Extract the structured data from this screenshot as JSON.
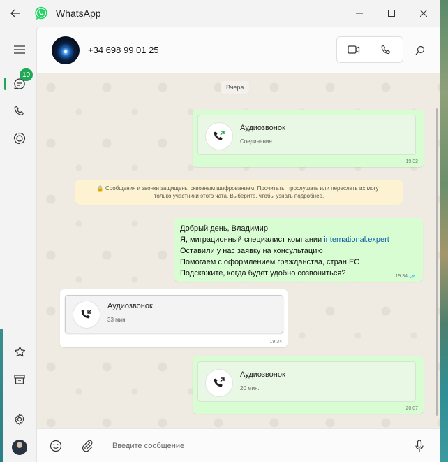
{
  "window": {
    "app_title": "WhatsApp"
  },
  "sidebar": {
    "chats_badge": "10"
  },
  "header": {
    "contact_name": "+34 698 99 01 25"
  },
  "date_separator": "Вчера",
  "messages": [
    {
      "type": "call",
      "direction": "out",
      "title": "Аудиозвонок",
      "subtitle": "Соединение",
      "time": "19:32"
    },
    {
      "type": "text",
      "direction": "out",
      "line1": "Добрый день, Владимир",
      "line2_prefix": "Я, миграционный специалист компании ",
      "line2_link": "international.expert",
      "line3": "Оставили у нас заявку на консультацию",
      "line4": "Помогаем с оформлением гражданства, стран ЕС",
      "line5": "Подскажите, когда будет удобно созвониться?",
      "time": "19:34"
    },
    {
      "type": "call",
      "direction": "in",
      "title": "Аудиозвонок",
      "subtitle": "33 мин.",
      "time": "19:34"
    },
    {
      "type": "call",
      "direction": "out",
      "title": "Аудиозвонок",
      "subtitle": "20 мин.",
      "time": "20:07"
    }
  ],
  "encryption_notice": {
    "line1": "🔒 Сообщения и звонки защищены сквозным шифрованием. Прочитать, прослушать или переслать их могут",
    "line2": "только участники этого чата. Выберите, чтобы узнать подробнее."
  },
  "composer": {
    "placeholder": "Введите сообщение"
  },
  "colors": {
    "accent": "#1fa855",
    "outgoing_bubble": "#d9fdd3",
    "incoming_bubble": "#ffffff",
    "notice": "#fdf3d2",
    "link": "#0b5fa5",
    "read_ticks": "#53bdeb"
  }
}
